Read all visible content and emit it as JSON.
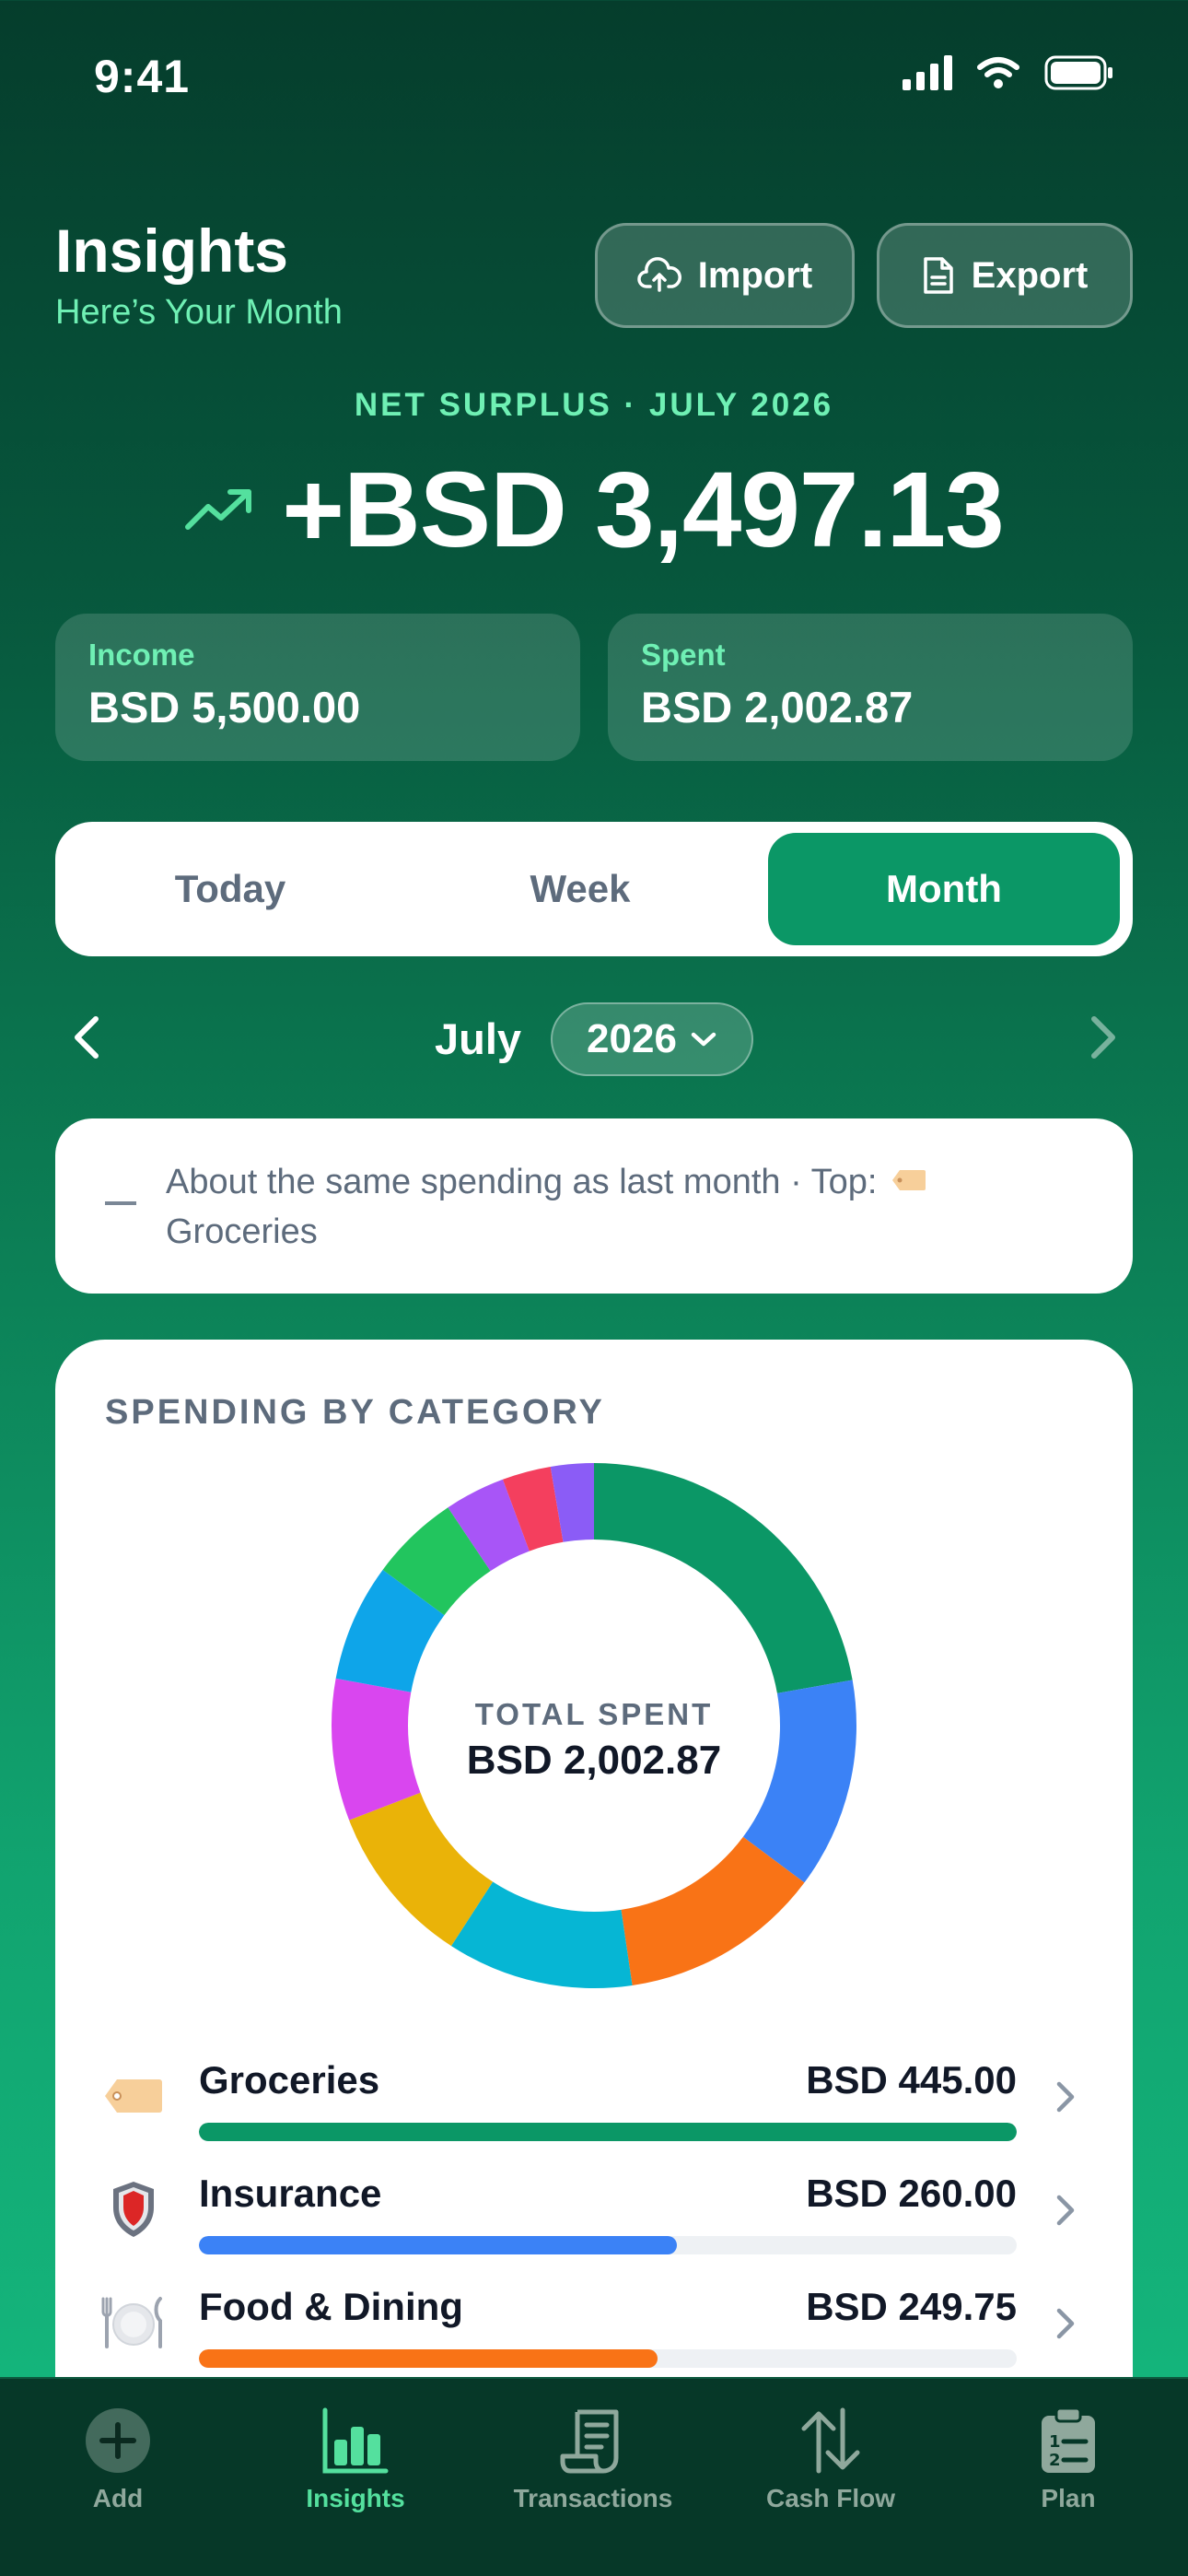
{
  "status_bar": {
    "time": "9:41"
  },
  "header": {
    "title": "Insights",
    "subtitle": "Here’s Your Month",
    "import_label": "Import",
    "export_label": "Export"
  },
  "summary": {
    "net_label": "NET SURPLUS · JULY 2026",
    "net_value": "+BSD 3,497.13",
    "income_label": "Income",
    "income_value": "BSD 5,500.00",
    "spent_label": "Spent",
    "spent_value": "BSD 2,002.87"
  },
  "period_tabs": {
    "today": "Today",
    "week": "Week",
    "month": "Month",
    "selected": "Month"
  },
  "month_nav": {
    "month": "July",
    "year": "2026"
  },
  "insight": {
    "text_before": "About the same spending as last month · Top:",
    "text_after": "Groceries"
  },
  "spending": {
    "title": "SPENDING BY CATEGORY",
    "total_label": "TOTAL SPENT",
    "total_value": "BSD 2,002.87",
    "categories": [
      {
        "name": "Groceries",
        "amount": "BSD 445.00",
        "value": 445.0,
        "color": "#0b9766",
        "icon": "tag-icon"
      },
      {
        "name": "Insurance",
        "amount": "BSD 260.00",
        "value": 260.0,
        "color": "#3b82f6",
        "icon": "shield-icon"
      },
      {
        "name": "Food & Dining",
        "amount": "BSD 249.75",
        "value": 249.75,
        "color": "#f97316",
        "icon": "plate-icon"
      }
    ],
    "donut_colors": [
      "#0b9766",
      "#3b82f6",
      "#f97316",
      "#06b6d4",
      "#eab308",
      "#d946ef",
      "#0ea5e9",
      "#22c55e",
      "#a855f7",
      "#f43f5e",
      "#8b5cf6"
    ],
    "donut_values": [
      445.0,
      260.0,
      249.75,
      230,
      200,
      175,
      145,
      110,
      75,
      60,
      53.12
    ]
  },
  "tab_bar": {
    "add": "Add",
    "insights": "Insights",
    "transactions": "Transactions",
    "cash_flow": "Cash Flow",
    "plan": "Plan",
    "active": "Insights"
  }
}
